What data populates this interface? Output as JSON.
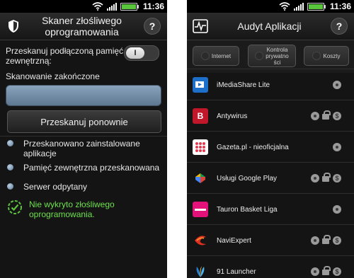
{
  "status": {
    "time": "11:36"
  },
  "left": {
    "title_line1": "Skaner złośliwego",
    "title_line2": "oprogramowania",
    "help": "?",
    "toggle_label_line1": "Przeskanuj podłączoną pamięć",
    "toggle_label_line2": "zewnętrzną:",
    "toggle_knob": "I",
    "scan_status": "Skanowanie zakończone",
    "scan_progress": 1.0,
    "rescan_button": "Przeskanuj ponownie",
    "results": [
      {
        "line1": "Przeskanowano zainstalowane",
        "line2": "aplikacje"
      },
      {
        "line1": "Pamięć zewnętrzna przeskanowana",
        "line2": ""
      },
      {
        "line1": "Serwer odpytany",
        "line2": ""
      }
    ],
    "final_line1": "Nie wykryto złośliwego",
    "final_line2": "oprogramowania."
  },
  "right": {
    "title": "Audyt Aplikacji",
    "help": "?",
    "filters": [
      {
        "line1": "Internet",
        "line2": "",
        "line3": ""
      },
      {
        "line1": "Kontrola",
        "line2": "prywatno",
        "line3": "ści"
      },
      {
        "line1": "Koszty",
        "line2": "",
        "line3": ""
      }
    ],
    "apps": [
      {
        "name": "iMediaShare Lite",
        "icon": "imediashare-icon",
        "color": "#1e6fc9",
        "lock": false,
        "cost": false
      },
      {
        "name": "Antywirus",
        "icon": "antywirus-icon",
        "color": "#c0182a",
        "lock": true,
        "cost": true
      },
      {
        "name": "Gazeta.pl - nieoficjalna",
        "icon": "gazeta-icon",
        "color": "#ffffff",
        "lock": false,
        "cost": false
      },
      {
        "name": "Usługi Google Play",
        "icon": "google-play-services-icon",
        "color": "#3fa64a",
        "lock": true,
        "cost": true
      },
      {
        "name": "Tauron Basket Liga",
        "icon": "tauron-icon",
        "color": "#e3127a",
        "lock": false,
        "cost": false
      },
      {
        "name": "NaviExpert",
        "icon": "naviexpert-icon",
        "color": "#e0301e",
        "lock": true,
        "cost": true
      },
      {
        "name": "91 Launcher",
        "icon": "launcher-91-icon",
        "color": "#2a7fd6",
        "lock": true,
        "cost": true
      }
    ],
    "antywirus_glyph": "B"
  }
}
